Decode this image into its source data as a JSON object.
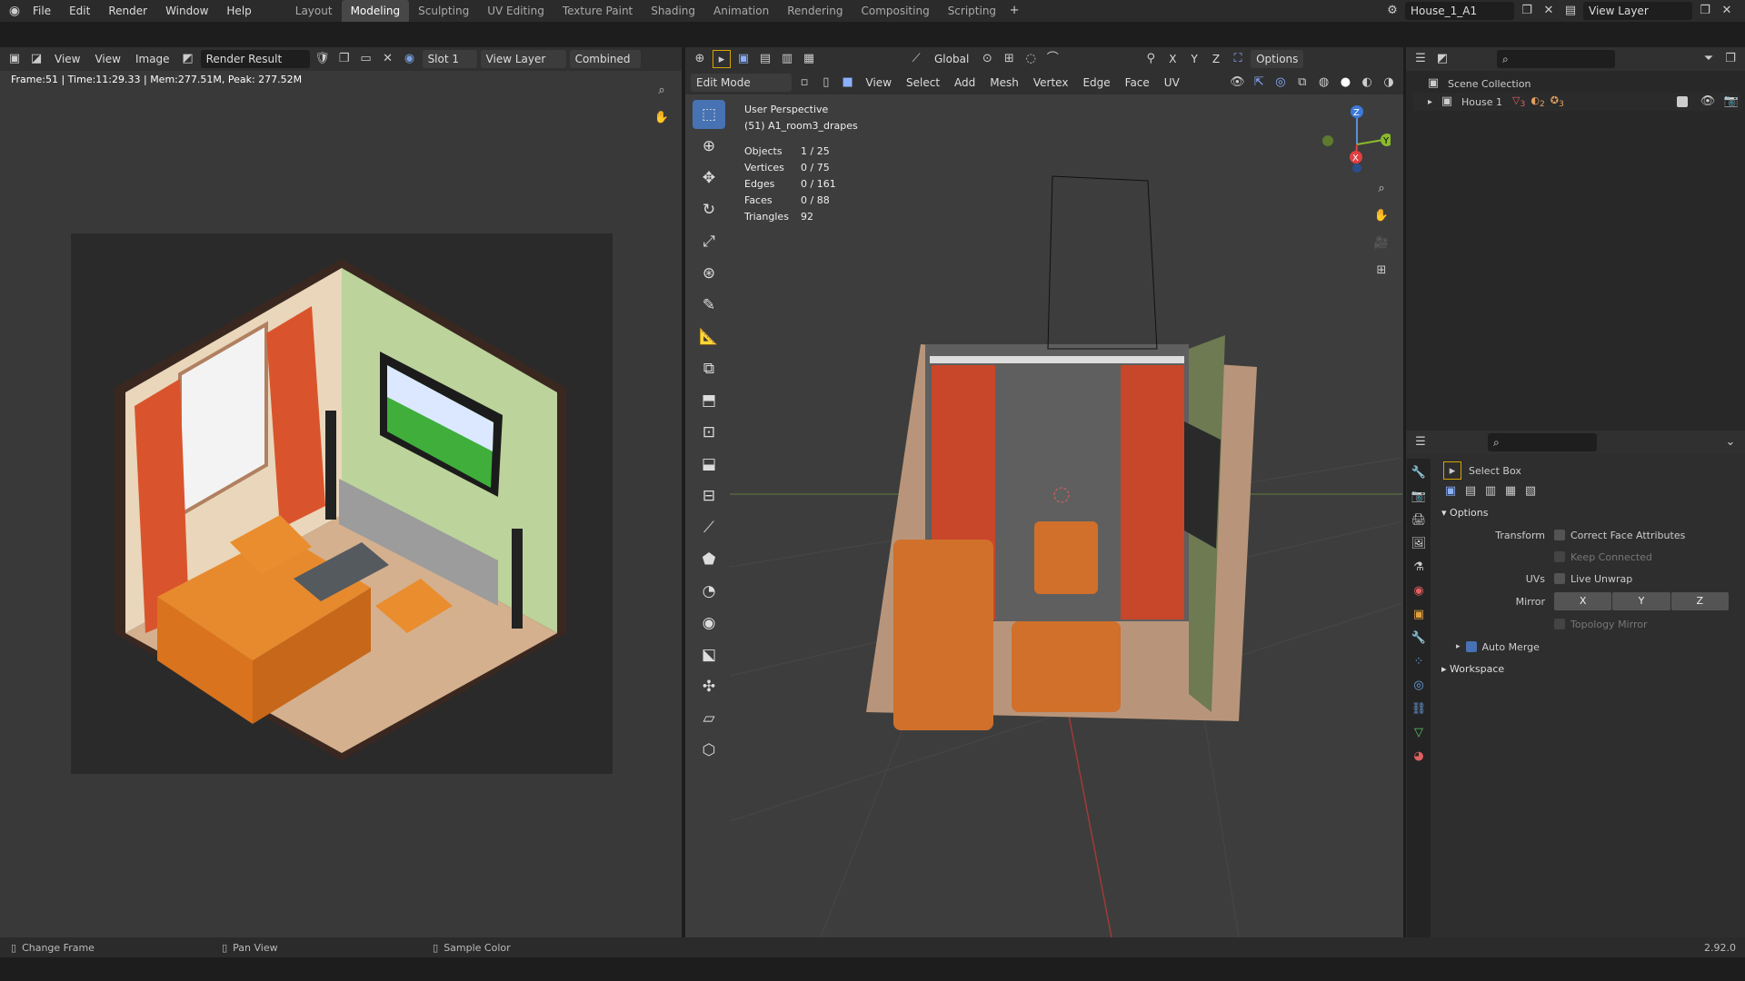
{
  "menus": [
    "File",
    "Edit",
    "Render",
    "Window",
    "Help"
  ],
  "workspaces": [
    "Layout",
    "Modeling",
    "Sculpting",
    "UV Editing",
    "Texture Paint",
    "Shading",
    "Animation",
    "Rendering",
    "Compositing",
    "Scripting"
  ],
  "active_workspace_index": 1,
  "scene_name": "House_1_A1",
  "view_layer": "View Layer",
  "image_editor": {
    "menus": [
      "View",
      "View",
      "Image"
    ],
    "image_name": "Render Result",
    "slot": "Slot 1",
    "layer": "View Layer",
    "pass": "Combined",
    "info": "Frame:51 | Time:11:29.33 | Mem:277.51M, Peak: 277.52M"
  },
  "viewport": {
    "orientation": "Global",
    "mode": "Edit Mode",
    "menus": [
      "View",
      "Select",
      "Add",
      "Mesh",
      "Vertex",
      "Edge",
      "Face",
      "UV"
    ],
    "options": "Options",
    "axes": [
      "X",
      "Y",
      "Z"
    ],
    "title": "User Perspective",
    "object": "(51) A1_room3_drapes",
    "stats": [
      {
        "label": "Objects",
        "value": "1 / 25"
      },
      {
        "label": "Vertices",
        "value": "0 / 75"
      },
      {
        "label": "Edges",
        "value": "0 / 161"
      },
      {
        "label": "Faces",
        "value": "0 / 88"
      },
      {
        "label": "Triangles",
        "value": "92"
      }
    ]
  },
  "outliner": {
    "scene_collection": "Scene Collection",
    "house": "House 1",
    "counts": [
      "3",
      "2",
      "3"
    ]
  },
  "properties": {
    "tool": "Select Box",
    "options_header": "Options",
    "transform_label": "Transform",
    "correct_face": "Correct Face Attributes",
    "keep_connected": "Keep Connected",
    "uvs_label": "UVs",
    "live_unwrap": "Live Unwrap",
    "mirror_label": "Mirror",
    "mirror_axes": [
      "X",
      "Y",
      "Z"
    ],
    "topology_mirror": "Topology Mirror",
    "auto_merge": "Auto Merge",
    "workspace": "Workspace"
  },
  "status": {
    "change_frame": "Change Frame",
    "pan_view": "Pan View",
    "sample_color": "Sample Color",
    "version": "2.92.0"
  },
  "colors": {
    "accent": "#4772b3",
    "curtain": "#d9542c",
    "sofa": "#e07d24",
    "wall": "#bdd29a"
  }
}
